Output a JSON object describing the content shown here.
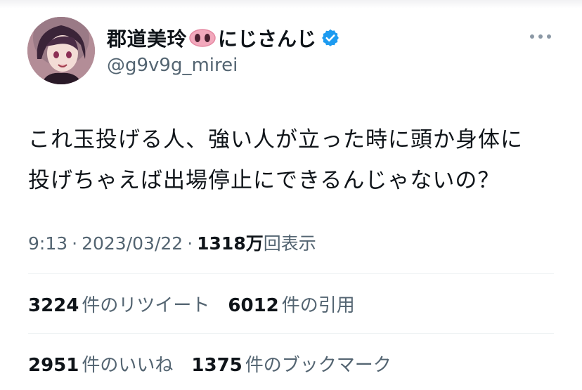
{
  "user": {
    "display_name": "郡道美玲",
    "display_name_suffix": "にじさんじ",
    "handle": "@g9v9g_mirei",
    "verified": true,
    "pig_emoji": "pig-nose-icon"
  },
  "tweet": {
    "lines": [
      "これ玉投げる人、強い人が立った時に頭か身体に",
      "投げちゃえば出場停止にできるんじゃないの？"
    ]
  },
  "meta": {
    "time": "9:13",
    "separator": "·",
    "date": "2023/03/22",
    "views_count": "1318万",
    "views_label": "回表示"
  },
  "stats": {
    "retweets": {
      "count": "3224",
      "label": "件のリツイート"
    },
    "quotes": {
      "count": "6012",
      "label": "件の引用"
    },
    "likes": {
      "count": "2951",
      "label": "件のいいね"
    },
    "bookmarks": {
      "count": "1375",
      "label": "件のブックマーク"
    }
  },
  "colors": {
    "verified": "#1d9bf0",
    "secondary_text": "#536471",
    "primary_text": "#0f1419",
    "divider": "#eff3f4"
  }
}
